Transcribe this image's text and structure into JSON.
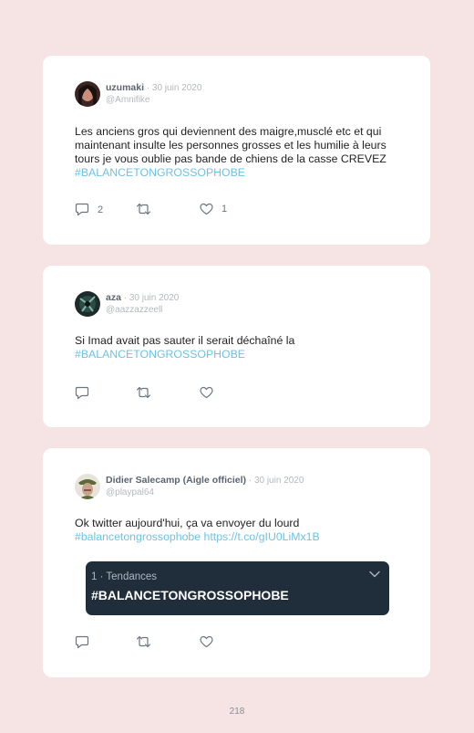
{
  "tweets": [
    {
      "display_name": "uzumaki",
      "separator": " · ",
      "date": "30 juin 2020",
      "handle": "@Amnifike",
      "text": "Les anciens gros qui deviennent des maigre,musclé etc et qui maintenant insulte les personnes grosses et les humilie à leurs tours je vous oublie pas bande de chiens de la casse CREVEZ ",
      "hashtag": "#BALANCETONGROSSOPHOBE",
      "reply_count": "2",
      "like_count": "1"
    },
    {
      "display_name": "aza",
      "separator": " · ",
      "date": "30 juin 2020",
      "handle": "@aazzazzeell",
      "text": "Si Imad avait pas sauter il serait déchaîné la ",
      "hashtag": "#BALANCETONGROSSOPHOBE"
    },
    {
      "display_name": "Didier Salecamp (Aigle officiel)",
      "separator": " · ",
      "date": "30 juin 2020",
      "handle": "@playpal64",
      "text": "Ok twitter aujourd'hui, ça va envoyer du lourd ",
      "hashtag": "#balancetongrossophobe",
      "link": "https://t.co/gIU0LiMx1B",
      "trend": {
        "meta": "1 · Tendances",
        "tag": "#BALANCETONGROSSOPHOBE"
      }
    }
  ],
  "page_number": "218",
  "icons": {
    "reply": "reply-icon",
    "retweet": "retweet-icon",
    "like": "heart-icon",
    "trend_toggle": "chevron-down-icon"
  },
  "colors": {
    "background": "#f6e3e3",
    "card": "#ffffff",
    "hashtag": "#6cc3e6",
    "trend_bg": "#1f2e3a"
  }
}
